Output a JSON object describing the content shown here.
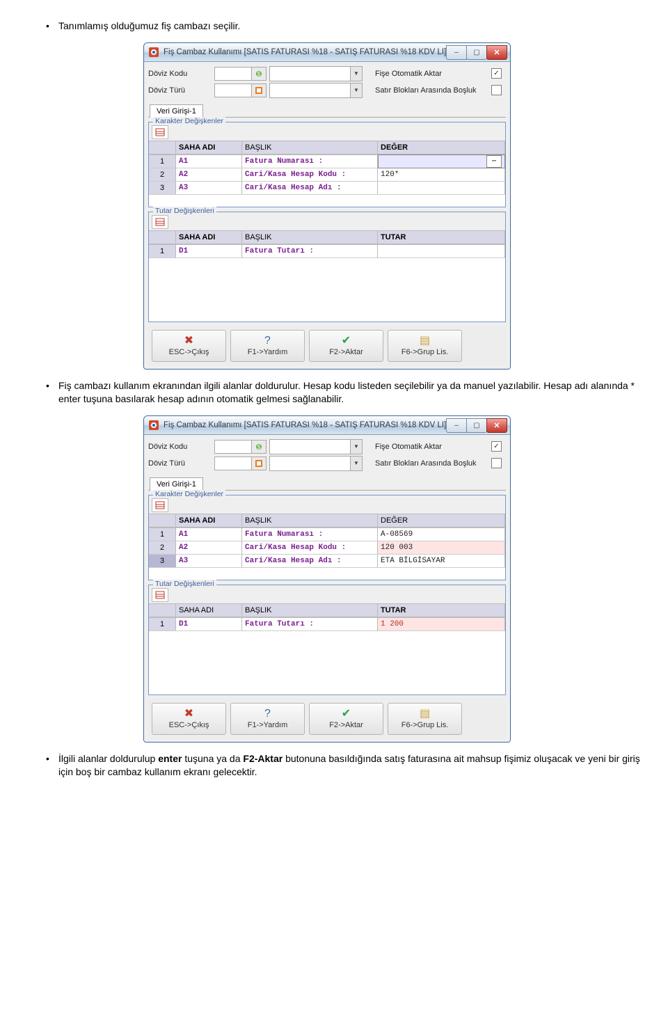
{
  "doc": {
    "p1": "Tanımlamış olduğumuz fiş cambazı seçilir.",
    "p2": "Fiş cambazı kullanım ekranından ilgili alanlar doldurulur. Hesap kodu listeden seçilebilir ya da manuel yazılabilir. Hesap adı alanında * enter tuşuna basılarak hesap adının otomatik gelmesi sağlanabilir.",
    "p3_a": "İlgili alanlar doldurulup ",
    "p3_b": "enter",
    "p3_c": " tuşuna ya da ",
    "p3_d": "F2-Aktar",
    "p3_e": " butonuna basıldığında satış faturasına ait mahsup fişimiz oluşacak ve yeni bir giriş için boş bir cambaz kullanım ekranı gelecektir."
  },
  "win": {
    "title": "Fiş Cambaz Kullanımı [SATIS FATURASI %18 - SATIŞ FATURASI %18 KDV Lİ]",
    "labels": {
      "dovizKodu": "Döviz Kodu",
      "dovizTuru": "Döviz Türü",
      "fiseOtomatik": "Fişe Otomatik Aktar",
      "satirBloklari": "Satır Blokları Arasında Boşluk"
    },
    "fiseChecked": "✓",
    "tab": "Veri Girişi-1",
    "grp_char": "Karakter Değişkenler",
    "grp_tut": "Tutar Değişkenleri",
    "headers": {
      "saha": "SAHA ADI",
      "baslik": "BAŞLIK",
      "deger": "DEĞER",
      "tutar": "TUTAR"
    },
    "char_rows_a": [
      {
        "n": "1",
        "s": "A1",
        "b": "Fatura Numarası  :",
        "d": ""
      },
      {
        "n": "2",
        "s": "A2",
        "b": "Cari/Kasa Hesap Kodu  :",
        "d": "120*"
      },
      {
        "n": "3",
        "s": "A3",
        "b": "Cari/Kasa Hesap Adı  :",
        "d": ""
      }
    ],
    "tut_rows_a": [
      {
        "n": "1",
        "s": "D1",
        "b": "Fatura Tutarı  :",
        "d": ""
      }
    ],
    "char_rows_b": [
      {
        "n": "1",
        "s": "A1",
        "b": "Fatura Numarası  :",
        "d": "A-08569"
      },
      {
        "n": "2",
        "s": "A2",
        "b": "Cari/Kasa Hesap Kodu  :",
        "d": "120 003"
      },
      {
        "n": "3",
        "s": "A3",
        "b": "Cari/Kasa Hesap Adı  :",
        "d": "ETA BİLGİSAYAR"
      }
    ],
    "tut_rows_b": [
      {
        "n": "1",
        "s": "D1",
        "b": "Fatura Tutarı  :",
        "d": "1 200"
      }
    ],
    "foot": {
      "esc": "ESC->Çıkış",
      "f1": "F1->Yardım",
      "f2": "F2->Aktar",
      "f6": "F6->Grup Lis."
    }
  }
}
